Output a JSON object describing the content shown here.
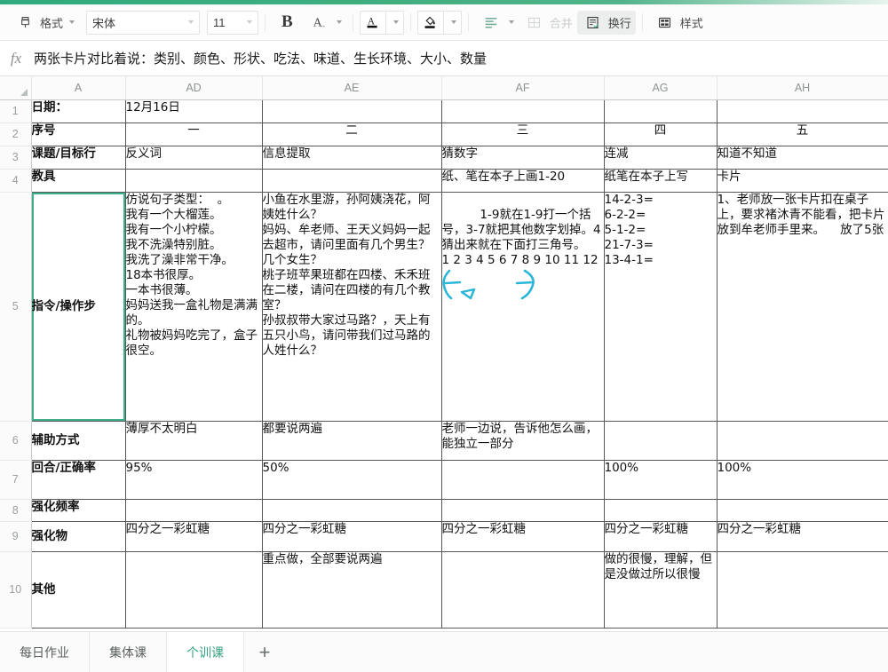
{
  "toolbar": {
    "format_label": "格式",
    "font_name": "宋体",
    "font_size": "11",
    "bold_label": "B",
    "font_color_label": "A",
    "text_color_label": "A",
    "fill_label": "",
    "merge_label": "合并",
    "wrap_label": "换行",
    "style_label": "样式",
    "accent_color": "#37a37e",
    "active_bg": "#eceeed"
  },
  "formula_bar": {
    "fx_label": "fx",
    "value": "两张卡片对比着说：类别、颜色、形状、吃法、味道、生长环境、大小、数量"
  },
  "grid": {
    "columns": [
      "A",
      "AD",
      "AE",
      "AF",
      "AG",
      "AH"
    ],
    "row_numbers": [
      "1",
      "2",
      "3",
      "4",
      "5",
      "6",
      "7",
      "8",
      "9",
      "10"
    ],
    "selected_cell": "A5",
    "rows": [
      {
        "num": "1",
        "cells": [
          "日期：",
          "12月16日",
          "",
          "",
          "",
          ""
        ]
      },
      {
        "num": "2",
        "cells": [
          "序号",
          "一",
          "二",
          "三",
          "四",
          "五"
        ]
      },
      {
        "num": "3",
        "cells": [
          "课题/目标行",
          "反义词",
          "信息提取",
          "猜数字",
          "连减",
          "知道不知道"
        ]
      },
      {
        "num": "4",
        "cells": [
          "教具",
          "",
          "",
          "纸、笔在本子上画1-20",
          "纸笔在本子上写",
          "卡片"
        ]
      },
      {
        "num": "5",
        "cells": [
          "指令/操作步",
          "仿说句子类型：  。\n我有一个大榴莲。\n我有一个小柠檬。\n我不洗澡特别脏。\n我洗了澡非常干净。\n18本书很厚。\n一本书很薄。\n妈妈送我一盒礼物是满满的。\n礼物被妈妈吃完了，盒子很空。",
          "小鱼在水里游，孙阿姨浇花，阿姨姓什么？\n妈妈、牟老师、王天义妈妈一起去超市，请问里面有几个男生？几个女生？\n桃子班苹果班都在四楼、禾禾班在二楼，请问在四楼的有几个教室？\n孙叔叔带大家过马路？，天上有五只小鸟，请问带我们过马路的人姓什么？",
          "1-9就在1-9打一个括号，3-7就把其他数字划掉。4猜出来就在下面打三角号。\n1 2 3 4 5 6 7 8 9 10 11 12",
          "14-2-3=\n6-2-2=\n5-1-2=\n21-7-3=\n13-4-1=",
          "1、老师放一张卡片扣在桌子上，要求褚沐青不能看，把卡片放到牟老师手里来。    放了5张"
        ]
      },
      {
        "num": "6",
        "cells": [
          "辅助方式",
          "薄厚不太明白",
          "都要说两遍",
          "老师一边说，告诉他怎么画，能独立一部分",
          "",
          ""
        ]
      },
      {
        "num": "7",
        "cells": [
          "回合/正确率",
          "95%",
          "50%",
          "",
          "100%",
          "100%"
        ]
      },
      {
        "num": "8",
        "cells": [
          "强化频率",
          "",
          "",
          "",
          "",
          ""
        ]
      },
      {
        "num": "9",
        "cells": [
          "强化物",
          "四分之一彩虹糖",
          "四分之一彩虹糖",
          "四分之一彩虹糖",
          "四分之一彩虹糖",
          "四分之一彩虹糖"
        ]
      },
      {
        "num": "10",
        "cells": [
          "其他",
          "",
          "重点做，全部要说两遍",
          "",
          "做的很慢，理解，但是没做过所以很慢",
          ""
        ]
      }
    ],
    "annotation": {
      "color": "#29b6d8",
      "description": "手写批注：1 前后括号，2 下方三角，8-9 划掉"
    }
  },
  "sheet_tabs": {
    "tabs": [
      {
        "label": "每日作业",
        "active": false
      },
      {
        "label": "集体课",
        "active": false
      },
      {
        "label": "个训课",
        "active": true
      }
    ],
    "add_label": "+"
  }
}
